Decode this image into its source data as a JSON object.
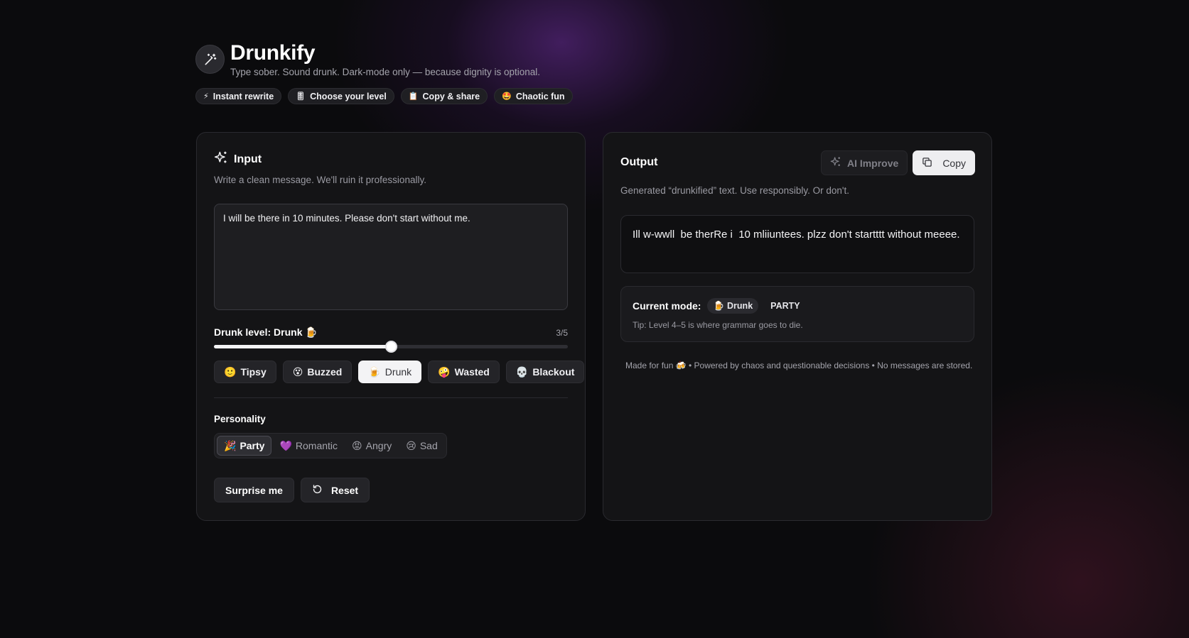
{
  "app": {
    "title": "Drunkify",
    "subtitle": "Type sober. Sound drunk. Dark-mode only — because dignity is optional.",
    "logo_icon": "magic-wand-icon"
  },
  "features": [
    {
      "icon": "⚡",
      "label": "Instant rewrite"
    },
    {
      "icon": "🎚",
      "label": "Choose your level"
    },
    {
      "icon": "📋",
      "label": "Copy & share"
    },
    {
      "icon": "🤩",
      "label": "Chaotic fun"
    }
  ],
  "input": {
    "title": "Input",
    "description": "Write a clean message. We'll ruin it professionally.",
    "text": "I will be there in 10 minutes. Please don't start without me.",
    "level_label": "Drunk level: Drunk 🍺",
    "level_count": "3/5",
    "level_value": 3,
    "level_max": 5,
    "levels": [
      {
        "icon": "🙂",
        "label": "Tipsy",
        "active": false
      },
      {
        "icon": "😵",
        "label": "Buzzed",
        "active": false
      },
      {
        "icon": "🍺",
        "label": "Drunk",
        "active": true
      },
      {
        "icon": "🤪",
        "label": "Wasted",
        "active": false
      },
      {
        "icon": "💀",
        "label": "Blackout",
        "active": false
      }
    ],
    "personality_label": "Personality",
    "personalities": [
      {
        "icon": "🎉",
        "label": "Party",
        "active": true
      },
      {
        "icon": "💜",
        "label": "Romantic",
        "active": false
      },
      {
        "icon": "😡",
        "label": "Angry",
        "active": false
      },
      {
        "icon": "😢",
        "label": "Sad",
        "active": false
      }
    ],
    "surprise_label": "Surprise me",
    "reset_label": "Reset"
  },
  "output": {
    "title": "Output",
    "ai_improve_label": "AI Improve",
    "copy_label": "Copy",
    "description": "Generated “drunkified” text. Use responsibly. Or don't.",
    "text": "Ill w-wwll  be therRe i  10 mliiuntees. plzz don't startttt without meeee.",
    "current_mode_label": "Current mode:",
    "mode_level_icon": "🍺",
    "mode_level": "Drunk",
    "mode_personality": "PARTY",
    "tip": "Tip: Level 4–5 is where grammar goes to die.",
    "footer": "Made for fun 🍻 • Powered by chaos and questionable decisions • No messages are stored."
  },
  "colors": {
    "background": "#0b0b0d",
    "card": "#141416",
    "accent_glow": "#6e2da0",
    "active_button": "#f3f3f5"
  }
}
